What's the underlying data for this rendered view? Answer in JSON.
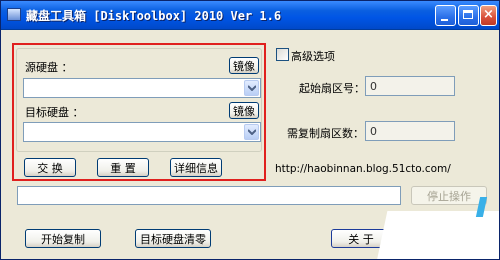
{
  "window": {
    "title": "藏盘工具箱 [DiskToolbox] 2010 Ver 1.6",
    "controls": {
      "minimize": "_",
      "maximize": "□",
      "close": "×"
    }
  },
  "source_disk": {
    "label": "源硬盘 ：",
    "image_button": "镜像",
    "value": ""
  },
  "target_disk": {
    "label": "目标硬盘 ：",
    "image_button": "镜像",
    "value": ""
  },
  "actions": {
    "swap": "交 换",
    "reset": "重 置",
    "details": "详细信息"
  },
  "advanced": {
    "checkbox_label": "高级选项",
    "checked": false,
    "start_sector_label": "起始扇区号：",
    "start_sector_value": "0",
    "copy_sectors_label": "需复制扇区数：",
    "copy_sectors_value": "0"
  },
  "url": "http://haobinnan.blog.51cto.com/",
  "progress": {
    "value": 0
  },
  "stop_button": "停止操作",
  "bottom": {
    "start_copy": "开始复制",
    "wipe_target": "目标硬盘清零",
    "about": "关 于"
  },
  "colors": {
    "title_bar": "#0055e5",
    "highlight_box": "#e0201e",
    "window_bg": "#ece9d8"
  }
}
